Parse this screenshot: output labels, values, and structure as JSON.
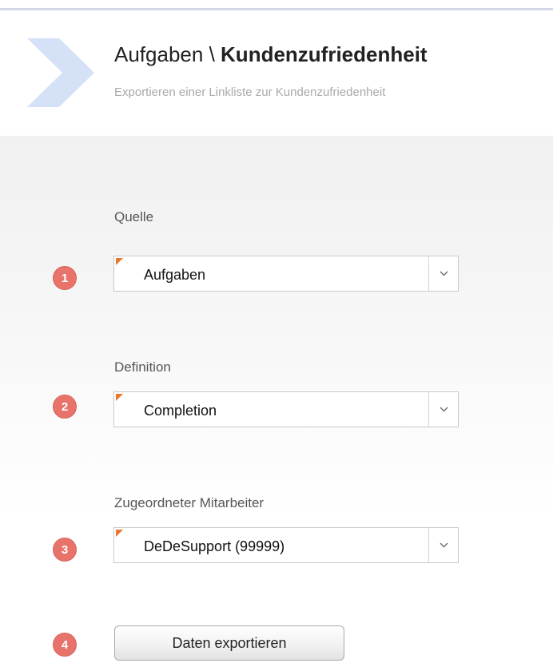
{
  "header": {
    "breadcrumb_parent": "Aufgaben",
    "breadcrumb_separator": "\\",
    "breadcrumb_current": "Kundenzufriedenheit",
    "subtitle": "Exportieren einer Linkliste zur Kundenzufriedenheit",
    "logo_icon": "chevron-right-icon",
    "accent_color": "#d4e1f6"
  },
  "form": {
    "source": {
      "badge": "1",
      "label": "Quelle",
      "value": "Aufgaben"
    },
    "definition": {
      "badge": "2",
      "label": "Definition",
      "value": "Completion"
    },
    "employee": {
      "badge": "3",
      "label": "Zugeordneter Mitarbeiter",
      "value": "DeDeSupport (99999)"
    },
    "export": {
      "badge": "4",
      "label": "Daten exportieren"
    }
  },
  "colors": {
    "badge": "#e8736b",
    "required_marker": "#e8792b"
  }
}
